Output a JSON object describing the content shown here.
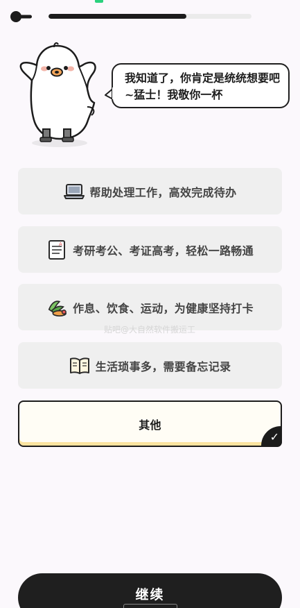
{
  "header": {
    "back_icon": "arrow-left-icon",
    "progress": 0.68
  },
  "mascot": {
    "speech": "我知道了，你肯定是统统想要吧~猛士！我敬你一杯"
  },
  "options": [
    {
      "icon": "laptop-icon",
      "label": "帮助处理工作，高效完成待办",
      "selected": false
    },
    {
      "icon": "notepad-icon",
      "label": "考研考公、考证高考，轻松一路畅通",
      "selected": false
    },
    {
      "icon": "fitness-icon",
      "label": "作息、饮食、运动，为健康坚持打卡",
      "selected": false
    },
    {
      "icon": "open-book-icon",
      "label": "生活琐事多，需要备忘记录",
      "selected": false
    },
    {
      "icon": "",
      "label": "其他",
      "selected": true
    }
  ],
  "watermark": "贴吧@大自然软件搬运工",
  "footer": {
    "continue_label": "继续"
  },
  "colors": {
    "dark": "#1c1c1c",
    "option_bg": "#efefef",
    "selected_accent": "#fbe3a0",
    "background": "#fbf8fc"
  }
}
